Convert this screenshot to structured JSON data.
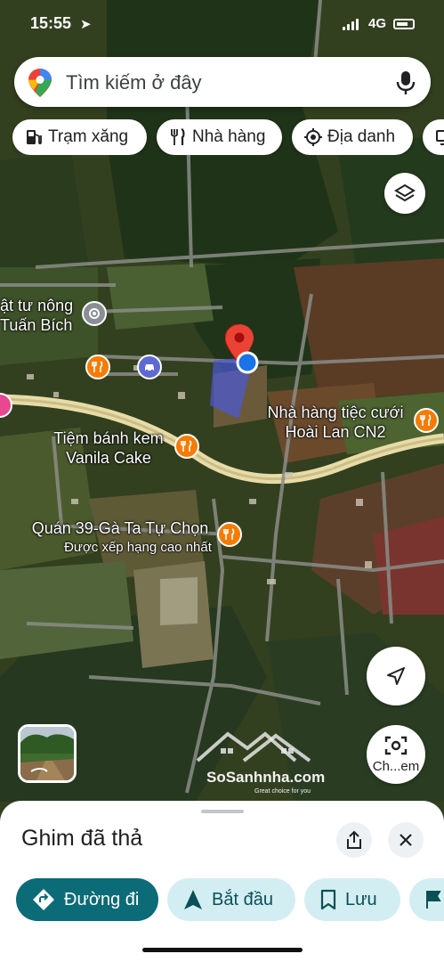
{
  "status_bar": {
    "time": "15:55",
    "network": "4G"
  },
  "search": {
    "placeholder": "Tìm kiếm ở đây"
  },
  "chips": [
    {
      "label": "Trạm xăng",
      "icon": "gas-station-icon"
    },
    {
      "label": "Nhà hàng",
      "icon": "restaurant-icon"
    },
    {
      "label": "Địa danh",
      "icon": "landmark-icon"
    }
  ],
  "map_labels": {
    "store": "ật tư nông\nTuấn Bích",
    "wedding_restaurant": "Nhà hàng tiệc cưới\nHoài Lan CN2",
    "cake_shop": "Tiệm bánh kem\nVanila Cake",
    "chicken_restaurant": "Quán 39-Gà Ta Tự Chọn",
    "chicken_restaurant_note": "Được xếp hạng cao nhất"
  },
  "street_view_button": {
    "label": "Ch...em"
  },
  "watermark": {
    "brand": "SoSanhnha.com",
    "tagline": "Great choice for you"
  },
  "sheet": {
    "title": "Ghim đã thả",
    "actions": [
      {
        "label": "Đường đi",
        "icon": "directions-icon"
      },
      {
        "label": "Bắt đầu",
        "icon": "navigation-arrow-icon"
      },
      {
        "label": "Lưu",
        "icon": "bookmark-icon"
      }
    ]
  },
  "colors": {
    "accent": "#0b6b76",
    "secondary_button": "#d3eef3",
    "pin": "#ea4335",
    "location_dot": "#1a73e8",
    "poi_orange": "#f57c00",
    "poi_gray": "#8a8f95",
    "poi_purple": "#5e6ad2"
  }
}
